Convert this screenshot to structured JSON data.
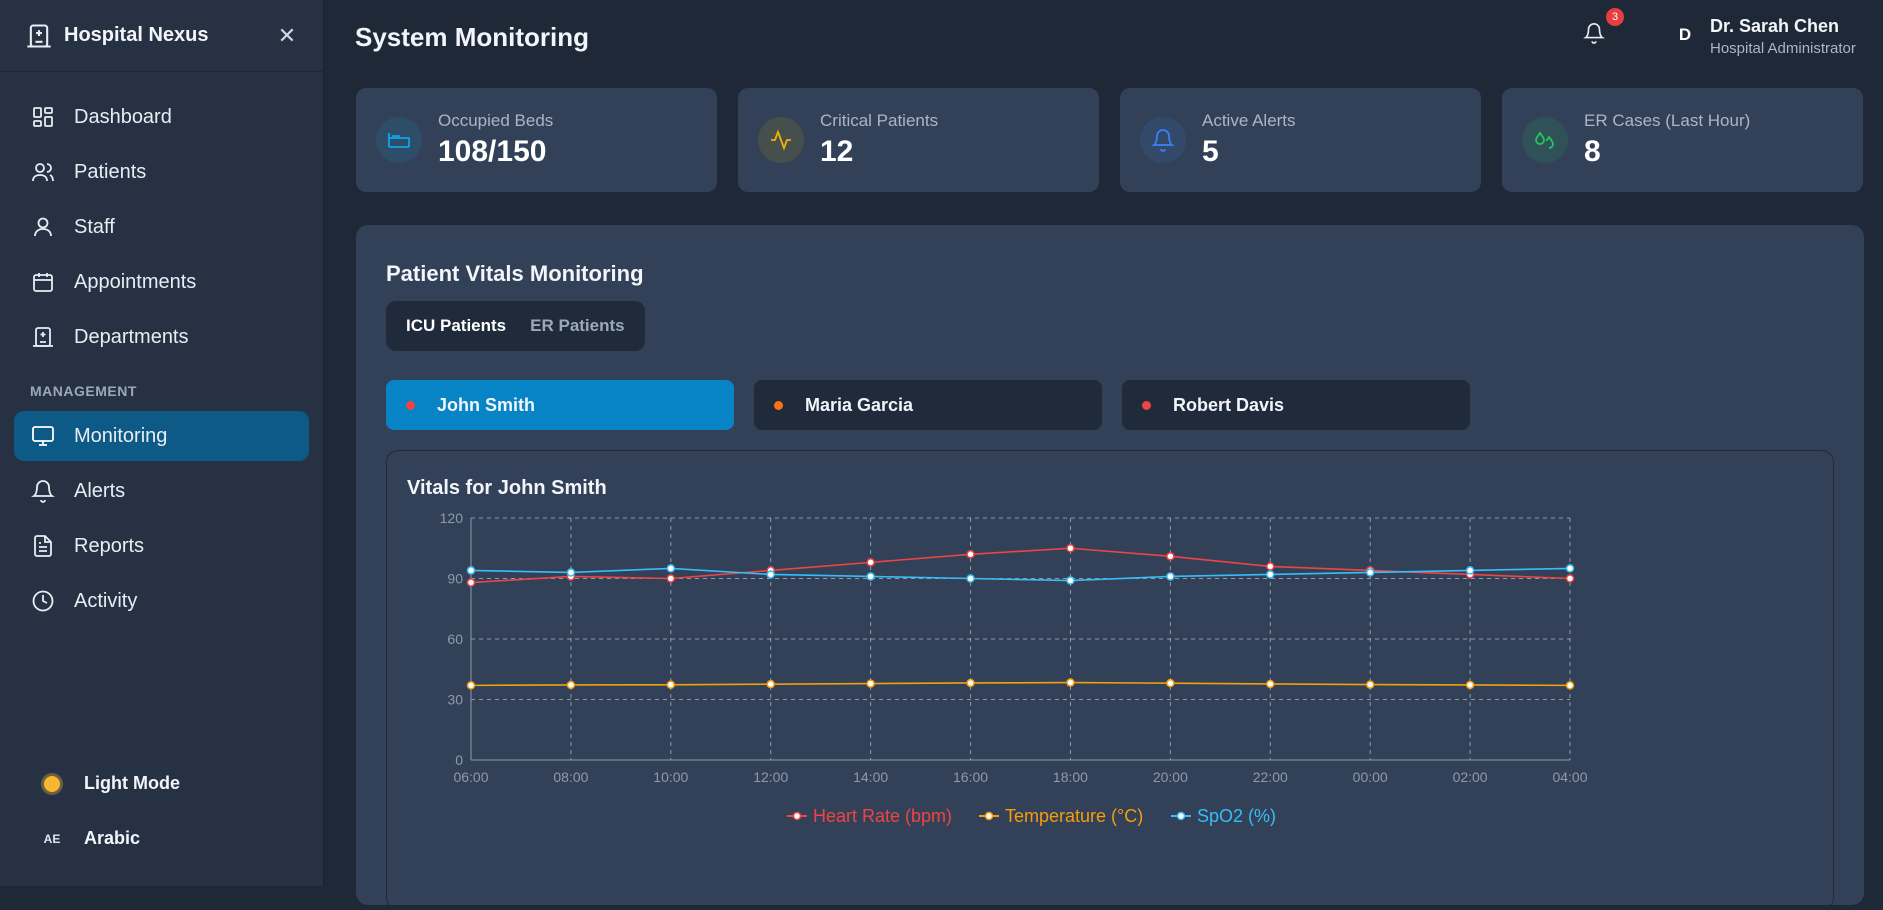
{
  "app": {
    "name": "Hospital Nexus"
  },
  "sidebar": {
    "items": [
      {
        "label": "Dashboard",
        "icon": "dashboard-icon"
      },
      {
        "label": "Patients",
        "icon": "users-icon"
      },
      {
        "label": "Staff",
        "icon": "user-icon"
      },
      {
        "label": "Appointments",
        "icon": "calendar-icon"
      },
      {
        "label": "Departments",
        "icon": "building-icon"
      }
    ],
    "section_label": "MANAGEMENT",
    "management_items": [
      {
        "label": "Monitoring",
        "icon": "monitor-icon",
        "active": true
      },
      {
        "label": "Alerts",
        "icon": "bell-icon"
      },
      {
        "label": "Reports",
        "icon": "report-icon"
      },
      {
        "label": "Activity",
        "icon": "clock-icon"
      }
    ],
    "light_mode_label": "Light Mode",
    "language_code": "AE",
    "language_label": "Arabic"
  },
  "header": {
    "title": "System Monitoring",
    "notification_count": "3",
    "avatar_initial": "D",
    "user_name": "Dr. Sarah Chen",
    "user_role": "Hospital Administrator"
  },
  "stats": [
    {
      "label": "Occupied Beds",
      "value": "108/150",
      "icon": "bed-icon",
      "color": "#0ea5e9"
    },
    {
      "label": "Critical Patients",
      "value": "12",
      "icon": "activity-icon",
      "color": "#eab308"
    },
    {
      "label": "Active Alerts",
      "value": "5",
      "icon": "bell-icon",
      "color": "#3b82f6"
    },
    {
      "label": "ER Cases (Last Hour)",
      "value": "8",
      "icon": "droplets-icon",
      "color": "#22c55e"
    }
  ],
  "vitals": {
    "title": "Patient Vitals Monitoring",
    "tabs": [
      "ICU Patients",
      "ER Patients"
    ],
    "active_tab": 0,
    "patients": [
      {
        "name": "John Smith",
        "dot_color": "#ef4444",
        "active": true
      },
      {
        "name": "Maria Garcia",
        "dot_color": "#f97316",
        "active": false
      },
      {
        "name": "Robert Davis",
        "dot_color": "#ef4444",
        "active": false
      }
    ],
    "chart_title": "Vitals for John Smith"
  },
  "chart_data": {
    "type": "line",
    "x": [
      "06:00",
      "08:00",
      "10:00",
      "12:00",
      "14:00",
      "16:00",
      "18:00",
      "20:00",
      "22:00",
      "00:00",
      "02:00",
      "04:00"
    ],
    "ylim": [
      0,
      120
    ],
    "yticks": [
      0,
      30,
      60,
      90,
      120
    ],
    "grid": true,
    "legend_position": "bottom",
    "series": [
      {
        "name": "Heart Rate (bpm)",
        "color": "#ef4444",
        "values": [
          88,
          91,
          90,
          94,
          98,
          102,
          105,
          101,
          96,
          94,
          92,
          90
        ]
      },
      {
        "name": "Temperature (°C)",
        "color": "#f59e0b",
        "values": [
          37.0,
          37.2,
          37.3,
          37.6,
          37.9,
          38.2,
          38.4,
          38.1,
          37.7,
          37.4,
          37.2,
          37.0
        ]
      },
      {
        "name": "SpO2 (%)",
        "color": "#38bdf8",
        "values": [
          94,
          93,
          95,
          92,
          91,
          90,
          89,
          91,
          92,
          93,
          94,
          95
        ]
      }
    ]
  }
}
